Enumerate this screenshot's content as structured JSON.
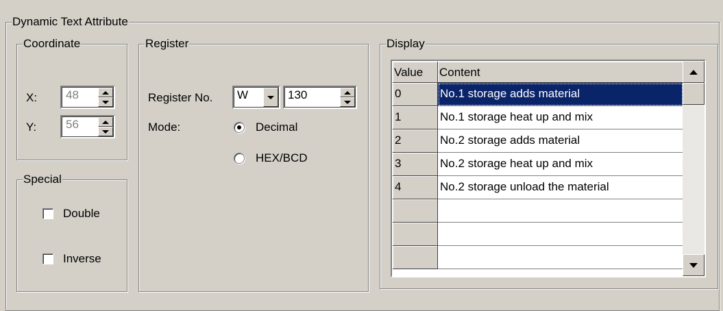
{
  "frame": {
    "title": "Dynamic Text Attribute"
  },
  "coordinate": {
    "title": "Coordinate",
    "x_label": "X:",
    "x_value": "48",
    "y_label": "Y:",
    "y_value": "56"
  },
  "special": {
    "title": "Special",
    "double_label": "Double",
    "double_checked": false,
    "inverse_label": "Inverse",
    "inverse_checked": false
  },
  "register": {
    "title": "Register",
    "register_no_label": "Register No.",
    "register_type": "W",
    "register_number": "130",
    "mode_label": "Mode:",
    "mode_options": [
      "Decimal",
      "HEX/BCD"
    ],
    "mode_selected": "Decimal"
  },
  "display": {
    "title": "Display",
    "columns": [
      "Value",
      "Content"
    ],
    "rows": [
      {
        "value": "0",
        "content": "No.1 storage  adds material",
        "selected": true
      },
      {
        "value": "1",
        "content": "No.1 storage heat up and mix",
        "selected": false
      },
      {
        "value": "2",
        "content": "No.2 storage  adds material",
        "selected": false
      },
      {
        "value": "3",
        "content": "No.2 storage heat up and mix",
        "selected": false
      },
      {
        "value": "4",
        "content": "No.2 storage unload the material",
        "selected": false
      },
      {
        "value": "",
        "content": "",
        "selected": false
      },
      {
        "value": "",
        "content": "",
        "selected": false
      },
      {
        "value": "",
        "content": "",
        "selected": false
      }
    ]
  },
  "icons": {
    "spin": "spin-up-down-icon",
    "dropdown": "chevron-down-icon",
    "scroll_up": "scroll-up-arrow-icon",
    "scroll_down": "scroll-down-arrow-icon"
  },
  "colors": {
    "background": "#d4d0c8",
    "selection": "#0a246a"
  }
}
